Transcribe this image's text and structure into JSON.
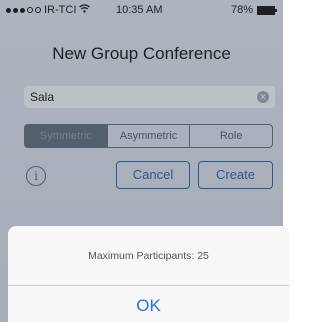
{
  "status_bar": {
    "carrier": "IR-TCI",
    "time": "10:35 AM",
    "battery": "78%"
  },
  "screen": {
    "title": "New Group Conference",
    "name_field_value": "Sala",
    "segments": [
      "Symmetric",
      "Asymmetric",
      "Role"
    ],
    "selected_segment": "Symmetric",
    "cancel_label": "Cancel",
    "create_label": "Create",
    "info_glyph": "i"
  },
  "alert": {
    "message": "Maximum Participants: 25",
    "ok_label": "OK"
  },
  "colors": {
    "accent": "#2a5ea8",
    "alert_button": "#2a6edb",
    "segment_selected": "#5d6a78"
  }
}
